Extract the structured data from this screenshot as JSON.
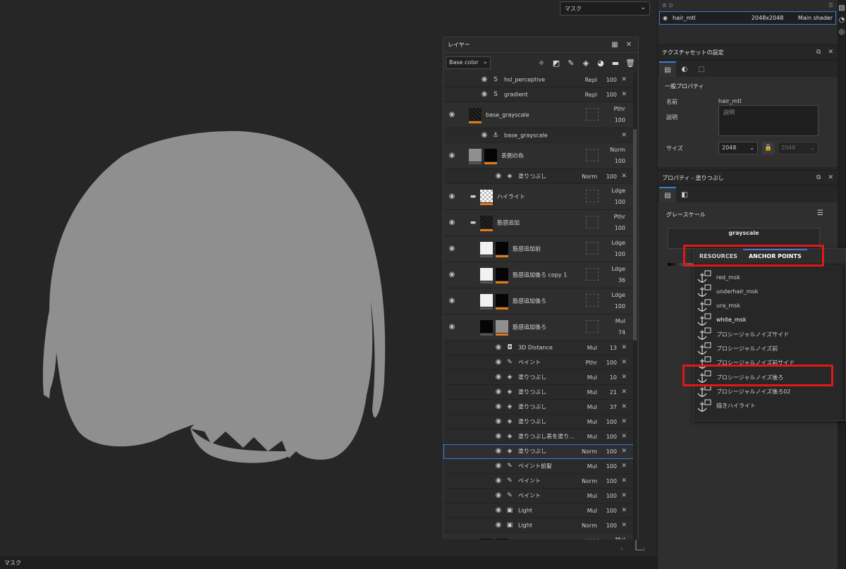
{
  "viewport": {
    "dropdown": "マスク",
    "bottom_label": "マスク"
  },
  "layers": {
    "title": "レイヤー",
    "channel": "Base color",
    "rows": [
      {
        "type": "short",
        "indent": 1,
        "eye": true,
        "icon": "smart-filter-icon",
        "name": "hsl_perceptive",
        "blend": "Repl",
        "opacity": "100"
      },
      {
        "type": "short",
        "indent": 1,
        "eye": true,
        "icon": "smart-filter-icon",
        "name": "gradient",
        "blend": "Repl",
        "opacity": "100"
      },
      {
        "type": "tall",
        "indent": 0,
        "eye": true,
        "name": "base_grayscale",
        "blend": "Pthr",
        "opacity": "100",
        "thumb": "dark",
        "mask": false
      },
      {
        "type": "short",
        "indent": 1,
        "eye": true,
        "icon": "anchor-icon",
        "name": "base_grayscale",
        "blend": "",
        "opacity": ""
      },
      {
        "type": "tall",
        "indent": 0,
        "eye": true,
        "name": "表側の色",
        "blend": "Norm",
        "opacity": "100",
        "thumb": "gray",
        "mask": true
      },
      {
        "type": "short",
        "indent": 2,
        "eye": true,
        "icon": "fill-icon",
        "name": "塗りつぶし",
        "blend": "Norm",
        "opacity": "100"
      },
      {
        "type": "tall",
        "indent": 0,
        "eye": true,
        "folder": true,
        "name": "ハイライト",
        "blend": "Ldge",
        "opacity": "100",
        "thumb": "checker"
      },
      {
        "type": "tall",
        "indent": 0,
        "eye": true,
        "folder": true,
        "name": "筋感追加",
        "blend": "Pthr",
        "opacity": "100",
        "thumb": "dark"
      },
      {
        "type": "tall",
        "indent": 1,
        "eye": true,
        "name": "筋感追加前",
        "blend": "Ldge",
        "opacity": "100",
        "thumb": "white",
        "mask": true
      },
      {
        "type": "tall",
        "indent": 1,
        "eye": true,
        "name": "筋感追加後ろ copy 1",
        "blend": "Ldge",
        "opacity": "36",
        "thumb": "white",
        "mask": true
      },
      {
        "type": "tall",
        "indent": 1,
        "eye": true,
        "name": "筋感追加後ろ",
        "blend": "Ldge",
        "opacity": "100",
        "thumb": "white",
        "mask": true
      },
      {
        "type": "tall",
        "indent": 1,
        "eye": true,
        "name": "筋感追加後ろ",
        "blend": "Mul",
        "opacity": "74",
        "thumb": "black",
        "mask": true,
        "mask_gray": true
      },
      {
        "type": "short",
        "indent": 2,
        "eye": true,
        "icon": "3d-distance-icon",
        "name": "3D Distance",
        "blend": "Mul",
        "opacity": "13"
      },
      {
        "type": "short",
        "indent": 2,
        "eye": true,
        "icon": "brush-icon",
        "name": "ペイント",
        "blend": "Pthr",
        "opacity": "100"
      },
      {
        "type": "short",
        "indent": 2,
        "eye": true,
        "icon": "fill-icon",
        "name": "塗りつぶし",
        "blend": "Mul",
        "opacity": "10"
      },
      {
        "type": "short",
        "indent": 2,
        "eye": true,
        "icon": "fill-icon",
        "name": "塗りつぶし",
        "blend": "Mul",
        "opacity": "21"
      },
      {
        "type": "short",
        "indent": 2,
        "eye": true,
        "icon": "fill-icon",
        "name": "塗りつぶし",
        "blend": "Mul",
        "opacity": "37"
      },
      {
        "type": "short",
        "indent": 2,
        "eye": true,
        "icon": "fill-icon",
        "name": "塗りつぶし",
        "blend": "Mul",
        "opacity": "100"
      },
      {
        "type": "short",
        "indent": 2,
        "eye": true,
        "icon": "fill-icon",
        "name": "塗りつぶし表を塗り…",
        "blend": "Mul",
        "opacity": "100"
      },
      {
        "type": "short",
        "indent": 2,
        "eye": true,
        "icon": "fill-icon",
        "name": "塗りつぶし",
        "blend": "Norm",
        "opacity": "100",
        "selected": true
      },
      {
        "type": "short",
        "indent": 2,
        "eye": true,
        "icon": "brush-icon",
        "name": "ペイント前髪",
        "blend": "Mul",
        "opacity": "100"
      },
      {
        "type": "short",
        "indent": 2,
        "eye": true,
        "icon": "brush-icon",
        "name": "ペイント",
        "blend": "Norm",
        "opacity": "100"
      },
      {
        "type": "short",
        "indent": 2,
        "eye": true,
        "icon": "brush-icon",
        "name": "ペイント",
        "blend": "Mul",
        "opacity": "100"
      },
      {
        "type": "short",
        "indent": 2,
        "eye": true,
        "icon": "light-icon",
        "name": "Light",
        "blend": "Mul",
        "opacity": "100"
      },
      {
        "type": "short",
        "indent": 2,
        "eye": true,
        "icon": "light-icon",
        "name": "Light",
        "blend": "Norm",
        "opacity": "100"
      },
      {
        "type": "tall",
        "indent": 1,
        "eye": false,
        "name": "",
        "blend": "Mul",
        "opacity": "",
        "thumb": "black",
        "mask": true
      }
    ]
  },
  "material": {
    "name": "hair_mtl",
    "size": "2048x2048",
    "shader": "Main shader"
  },
  "texset": {
    "title": "テクスチャセットの設定",
    "section": "一般プロパティ",
    "name_label": "名前",
    "name_value": "hair_mtl",
    "desc_label": "説明",
    "desc_placeholder": "説明",
    "size_label": "サイズ",
    "size_value": "2048",
    "size_value2": "2048"
  },
  "fill_props": {
    "title": "プロパティ - 塗りつぶし",
    "section": "グレースケール",
    "button": "grayscale"
  },
  "popup": {
    "tab_resources": "RESOURCES",
    "tab_anchor": "ANCHOR POINTS",
    "items": [
      "red_msk",
      "underhair_msk",
      "ura_msk",
      "white_msk",
      "プロシージャルノイズサイド",
      "プロシージャルノイズ前",
      "プロシージャルノイズ前サイド",
      "プロシージャルノイズ後ろ",
      "プロシージャルノイズ後ろ02",
      "描きハイライト"
    ]
  },
  "colors": {
    "accent": "#3b7bd4",
    "highlight": "#e01818",
    "orange": "#e07a1a",
    "hair": "#8f8f8f"
  }
}
